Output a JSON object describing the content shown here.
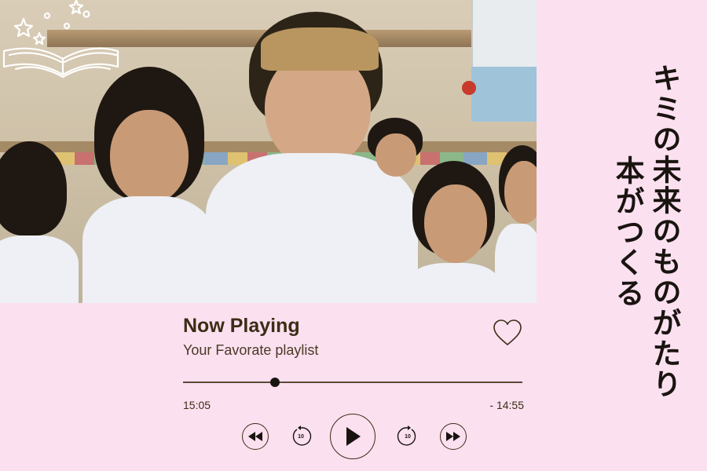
{
  "photo": {
    "alt_icon": "classroom-photo"
  },
  "title": {
    "line1": "本がつくる",
    "line2": "キミの未来のものがたり"
  },
  "player": {
    "title": "Now Playing",
    "subtitle": "Your Favorate playlist",
    "elapsed": "15:05",
    "remaining": "- 14:55",
    "progress_fraction": 0.27,
    "rewind_seconds": "10",
    "forward_seconds": "10"
  },
  "icons": {
    "book": "open-book-icon",
    "heart": "heart-icon",
    "prev": "skip-previous-icon",
    "rewind": "rewind-10-icon",
    "play": "play-icon",
    "forward": "forward-10-icon",
    "next": "skip-next-icon"
  },
  "colors": {
    "background": "#fbe0f0",
    "text": "#3b2d14"
  }
}
